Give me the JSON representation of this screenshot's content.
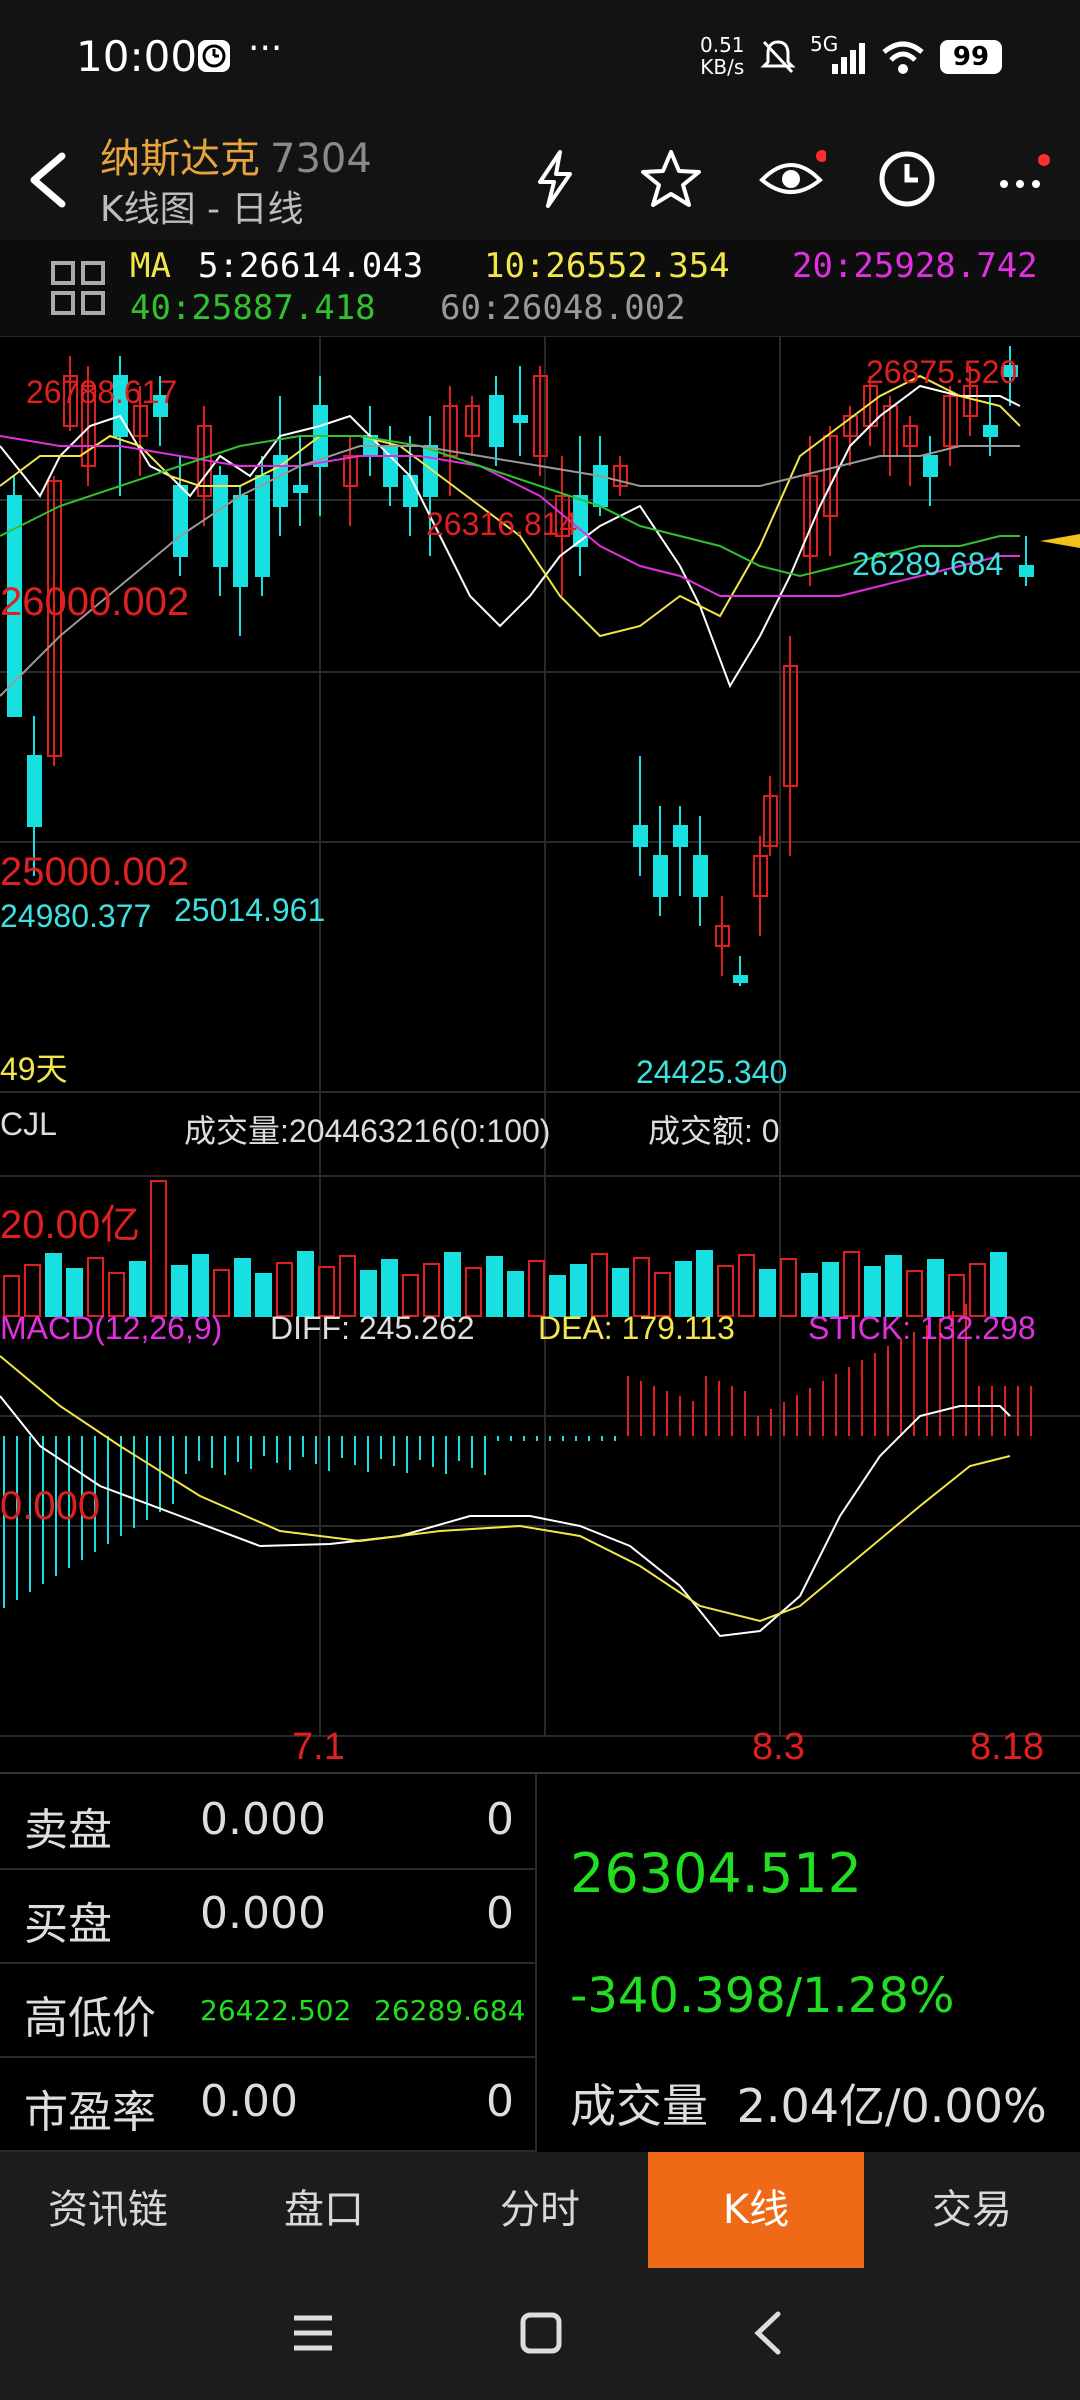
{
  "status_bar": {
    "time": "10:00",
    "net_speed": "0.51",
    "net_unit": "KB/s",
    "signal": "5G",
    "battery": "99"
  },
  "header": {
    "name": "纳斯达克",
    "code": "7304",
    "subtitle": "K线图 - 日线"
  },
  "ma": {
    "label": "MA",
    "ma5": "5:26614.043",
    "ma10": "10:26552.354",
    "ma20": "20:25928.742",
    "ma40": "40:25887.418",
    "ma60": "60:26048.002"
  },
  "kline": {
    "price_labels": {
      "high_left": "26788.617",
      "high_mid": "26316.814",
      "high_right": "26875.520",
      "level_26000": "26000.002",
      "level_25000": "25000.002",
      "low_left": "24980.377",
      "low_left2": "25014.961",
      "low_mid": "24425.340",
      "right_low": "26289.684",
      "days": "49天"
    }
  },
  "volume": {
    "title": "CJL",
    "volume": "成交量:204463216(0:100)",
    "amount": "成交额: 0",
    "level": "20.00亿"
  },
  "macd": {
    "title": "MACD(12,26,9)",
    "diff": "DIFF: 245.262",
    "dea": "DEA: 179.113",
    "stick": "STICK: 132.298",
    "zero": "0.000"
  },
  "dates": [
    "7.1",
    "8.3",
    "8.18"
  ],
  "quote": {
    "rows": [
      {
        "label": "卖盘",
        "value": "0.000",
        "count": "0"
      },
      {
        "label": "买盘",
        "value": "0.000",
        "count": "0"
      },
      {
        "label": "高低价",
        "high": "26422.502",
        "low": "26289.684"
      },
      {
        "label": "市盈率",
        "value": "0.00",
        "count": "0"
      }
    ],
    "price": "26304.512",
    "change": "-340.398/1.28%",
    "vol_label": "成交量",
    "vol_value": "2.04亿/0.00%"
  },
  "tabs": [
    "资讯链",
    "盘口",
    "分时",
    "K线",
    "交易"
  ],
  "colors": {
    "up": "#e02020",
    "down": "#19e0e0",
    "ma5": "#ffffff",
    "ma10": "#f2e64a",
    "ma20": "#e030e0",
    "ma40": "#30c030",
    "ma60": "#999999",
    "accent": "#ee6a17",
    "gain_text": "#22dd22"
  }
}
